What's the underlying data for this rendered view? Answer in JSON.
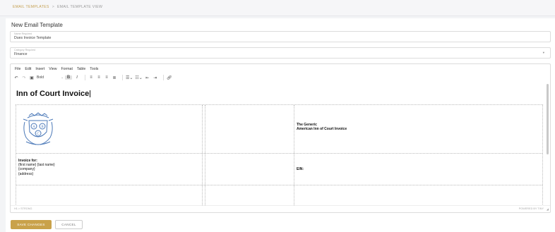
{
  "breadcrumb": {
    "first": "EMAIL TEMPLATES",
    "separator": ">",
    "second": "EMAIL TEMPLATE VIEW"
  },
  "page_title": "New Email Template",
  "name_field": {
    "label": "Name Required",
    "value": "Dues Invoice Template"
  },
  "category_field": {
    "label": "Category Required",
    "value": "Finance"
  },
  "editor": {
    "menu": [
      "File",
      "Edit",
      "Insert",
      "View",
      "Format",
      "Table",
      "Tools"
    ],
    "block_format": "Bold",
    "toolbar_icons": [
      "undo-icon",
      "redo-icon",
      "save-icon",
      "bold-icon",
      "italic-icon",
      "align-left-icon",
      "align-center-icon",
      "align-right-icon",
      "align-justify-icon",
      "bullet-list-icon",
      "numbered-list-icon",
      "outdent-icon",
      "indent-icon",
      "link-icon"
    ],
    "doc_title": "Inn of Court Invoice",
    "header_right_line1": "The Generic",
    "header_right_line2": "American Inn of Court Invoice",
    "invoice_for_label": "Invoice for:",
    "invoice_for_lines": [
      "{first name} {last name}",
      "{company}",
      "{address}"
    ],
    "ein_label": "EIN:",
    "status_path": "H1 > STRONG",
    "powered_by": "POWERED BY TINY"
  },
  "buttons": {
    "save": "SAVE CHANGES",
    "cancel": "CANCEL"
  },
  "colors": {
    "accent": "#c9a24a",
    "logo_blue": "#4a78b8"
  }
}
